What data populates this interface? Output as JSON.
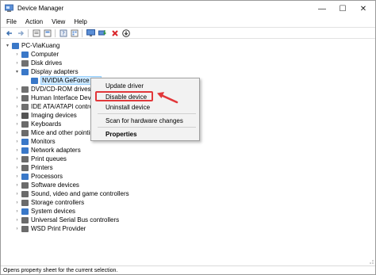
{
  "window": {
    "title": "Device Manager",
    "controls": {
      "minimize": "—",
      "maximize": "☐",
      "close": "✕"
    }
  },
  "menu": [
    "File",
    "Action",
    "View",
    "Help"
  ],
  "toolbar": {
    "icons": [
      "back-icon",
      "forward-icon",
      "properties-icon",
      "help-icon",
      "scan-icon",
      "monitor-icon",
      "update-driver-icon",
      "uninstall-icon",
      "download-icon"
    ]
  },
  "tree": {
    "root": "PC-ViaKuang",
    "nodes": [
      {
        "label": "Computer",
        "icon": "computer-icon",
        "color": "#3a78c8"
      },
      {
        "label": "Disk drives",
        "icon": "disk-icon",
        "color": "#707070"
      },
      {
        "label": "Display adapters",
        "icon": "display-adapter-icon",
        "color": "#3a78c8"
      },
      {
        "label": "NVIDIA GeForce GT",
        "icon": "display-adapter-icon",
        "color": "#3a78c8"
      },
      {
        "label": "DVD/CD-ROM drives",
        "icon": "dvd-icon",
        "color": "#707070"
      },
      {
        "label": "Human Interface Dev",
        "icon": "hid-icon",
        "color": "#6b6b6b"
      },
      {
        "label": "IDE ATA/ATAPI control",
        "icon": "ide-icon",
        "color": "#707070"
      },
      {
        "label": "Imaging devices",
        "icon": "camera-icon",
        "color": "#555555"
      },
      {
        "label": "Keyboards",
        "icon": "keyboard-icon",
        "color": "#6b6b6b"
      },
      {
        "label": "Mice and other pointin",
        "icon": "mouse-icon",
        "color": "#6b6b6b"
      },
      {
        "label": "Monitors",
        "icon": "monitor-icon",
        "color": "#3a78c8"
      },
      {
        "label": "Network adapters",
        "icon": "network-icon",
        "color": "#3a78c8"
      },
      {
        "label": "Print queues",
        "icon": "printer-icon",
        "color": "#6b6b6b"
      },
      {
        "label": "Printers",
        "icon": "printer-icon",
        "color": "#6b6b6b"
      },
      {
        "label": "Processors",
        "icon": "processor-icon",
        "color": "#3a78c8"
      },
      {
        "label": "Software devices",
        "icon": "software-icon",
        "color": "#6b6b6b"
      },
      {
        "label": "Sound, video and game controllers",
        "icon": "sound-icon",
        "color": "#6b6b6b"
      },
      {
        "label": "Storage controllers",
        "icon": "storage-icon",
        "color": "#6b6b6b"
      },
      {
        "label": "System devices",
        "icon": "system-icon",
        "color": "#3a78c8"
      },
      {
        "label": "Universal Serial Bus controllers",
        "icon": "usb-icon",
        "color": "#6b6b6b"
      },
      {
        "label": "WSD Print Provider",
        "icon": "printer-icon",
        "color": "#6b6b6b"
      }
    ]
  },
  "context_menu": {
    "update_driver": "Update driver",
    "disable_device": "Disable device",
    "uninstall_device": "Uninstall device",
    "scan": "Scan for hardware changes",
    "properties": "Properties"
  },
  "annotation": {
    "highlight_color": "#e2373a"
  },
  "status": "Opens property sheet for the current selection."
}
